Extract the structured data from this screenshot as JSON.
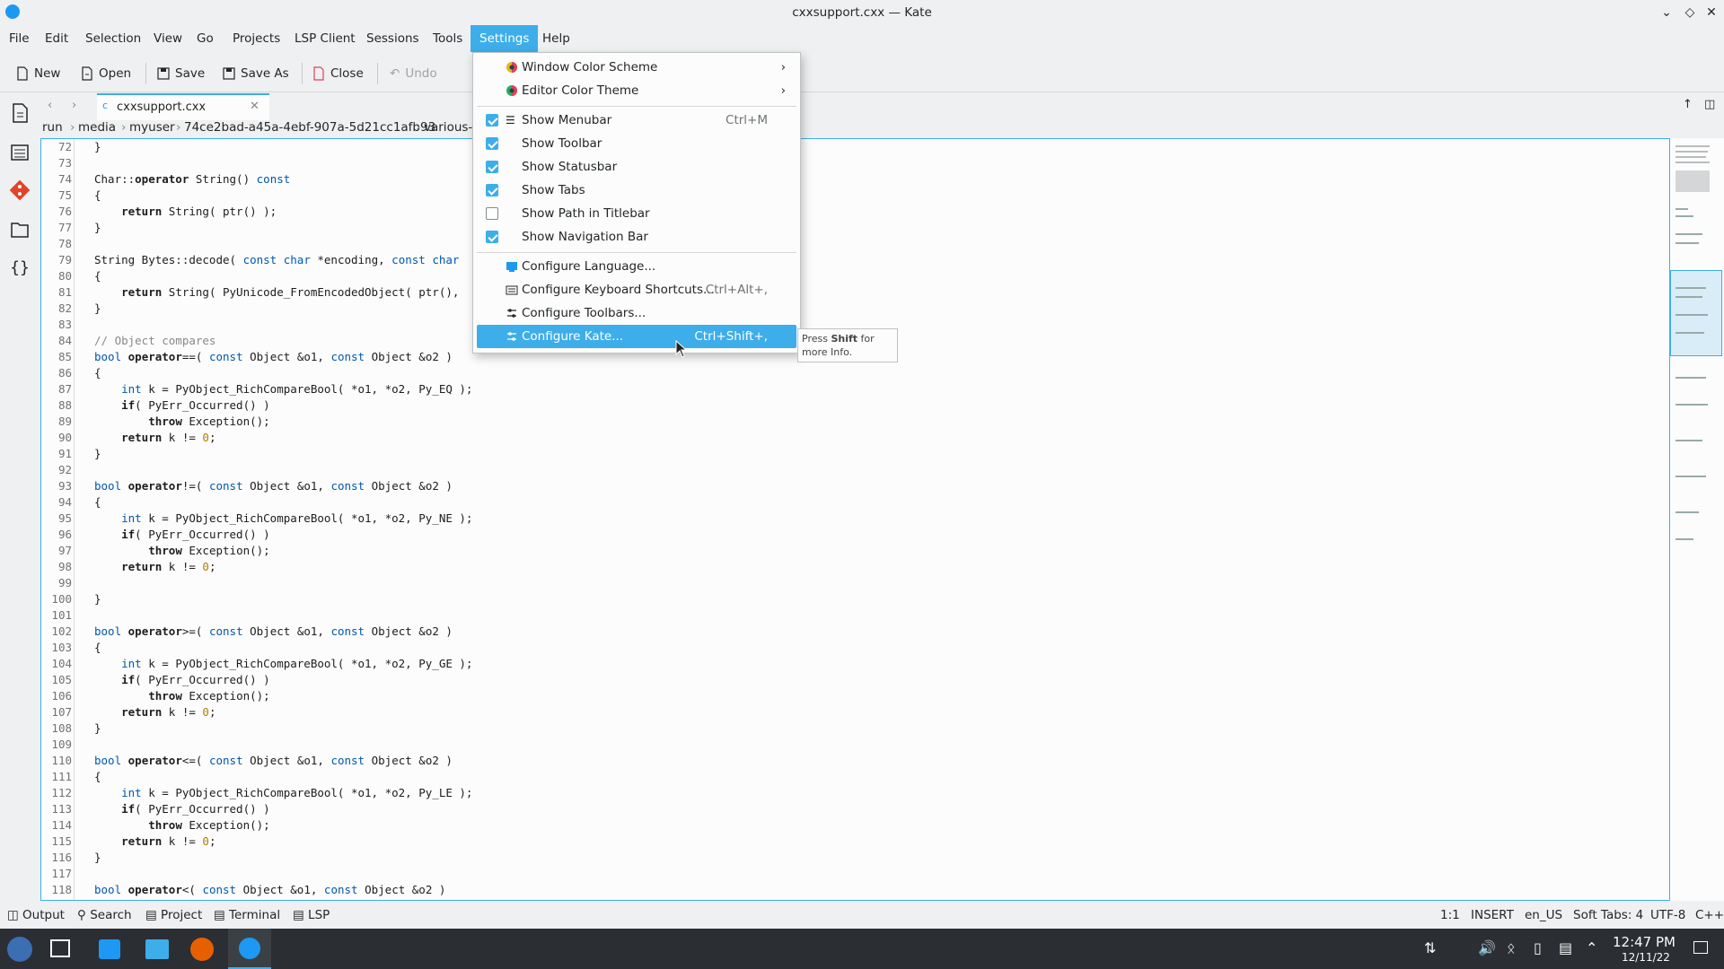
{
  "window": {
    "title": "cxxsupport.cxx — Kate"
  },
  "menubar": [
    "File",
    "Edit",
    "Selection",
    "View",
    "Go",
    "Projects",
    "LSP Client",
    "Sessions",
    "Tools",
    "Settings",
    "Help"
  ],
  "toolbar": {
    "new": "New",
    "open": "Open",
    "save": "Save",
    "save_as": "Save As",
    "close": "Close",
    "undo": "Undo"
  },
  "tab": {
    "name": "cxxsupport.cxx"
  },
  "breadcrumb": [
    "run",
    "media",
    "myuser",
    "74ce2bad-a45a-4ebf-907a-5d21cc1afb93",
    "various-f"
  ],
  "settings_menu": {
    "window_color_scheme": "Window Color Scheme",
    "editor_color_theme": "Editor Color Theme",
    "show_menubar": "Show Menubar",
    "show_menubar_sc": "Ctrl+M",
    "show_toolbar": "Show Toolbar",
    "show_statusbar": "Show Statusbar",
    "show_tabs": "Show Tabs",
    "show_path": "Show Path in Titlebar",
    "show_navbar": "Show Navigation Bar",
    "configure_language": "Configure Language...",
    "configure_shortcuts": "Configure Keyboard Shortcuts...",
    "configure_shortcuts_sc": "Ctrl+Alt+,",
    "configure_toolbars": "Configure Toolbars...",
    "configure_kate": "Configure Kate...",
    "configure_kate_sc": "Ctrl+Shift+,"
  },
  "tooltip": {
    "pre": "Press ",
    "bold": "Shift",
    "post": " for more Info."
  },
  "code_lines": [
    {
      "n": "72",
      "t": "}"
    },
    {
      "n": "73",
      "t": ""
    },
    {
      "n": "74",
      "t": "Char::operator String() const"
    },
    {
      "n": "75",
      "t": "{"
    },
    {
      "n": "76",
      "t": "    return String( ptr() );"
    },
    {
      "n": "77",
      "t": "}"
    },
    {
      "n": "78",
      "t": ""
    },
    {
      "n": "79",
      "t": "String Bytes::decode( const char *encoding, const char"
    },
    {
      "n": "80",
      "t": "{"
    },
    {
      "n": "81",
      "t": "    return String( PyUnicode_FromEncodedObject( ptr(),"
    },
    {
      "n": "82",
      "t": "}"
    },
    {
      "n": "83",
      "t": ""
    },
    {
      "n": "84",
      "t": "// Object compares"
    },
    {
      "n": "85",
      "t": "bool operator==( const Object &o1, const Object &o2 )"
    },
    {
      "n": "86",
      "t": "{"
    },
    {
      "n": "87",
      "t": "    int k = PyObject_RichCompareBool( *o1, *o2, Py_EQ );"
    },
    {
      "n": "88",
      "t": "    if( PyErr_Occurred() )"
    },
    {
      "n": "89",
      "t": "        throw Exception();"
    },
    {
      "n": "90",
      "t": "    return k != 0;"
    },
    {
      "n": "91",
      "t": "}"
    },
    {
      "n": "92",
      "t": ""
    },
    {
      "n": "93",
      "t": "bool operator!=( const Object &o1, const Object &o2 )"
    },
    {
      "n": "94",
      "t": "{"
    },
    {
      "n": "95",
      "t": "    int k = PyObject_RichCompareBool( *o1, *o2, Py_NE );"
    },
    {
      "n": "96",
      "t": "    if( PyErr_Occurred() )"
    },
    {
      "n": "97",
      "t": "        throw Exception();"
    },
    {
      "n": "98",
      "t": "    return k != 0;"
    },
    {
      "n": "99",
      "t": ""
    },
    {
      "n": "100",
      "t": "}"
    },
    {
      "n": "101",
      "t": ""
    },
    {
      "n": "102",
      "t": "bool operator>=( const Object &o1, const Object &o2 )"
    },
    {
      "n": "103",
      "t": "{"
    },
    {
      "n": "104",
      "t": "    int k = PyObject_RichCompareBool( *o1, *o2, Py_GE );"
    },
    {
      "n": "105",
      "t": "    if( PyErr_Occurred() )"
    },
    {
      "n": "106",
      "t": "        throw Exception();"
    },
    {
      "n": "107",
      "t": "    return k != 0;"
    },
    {
      "n": "108",
      "t": "}"
    },
    {
      "n": "109",
      "t": ""
    },
    {
      "n": "110",
      "t": "bool operator<=( const Object &o1, const Object &o2 )"
    },
    {
      "n": "111",
      "t": "{"
    },
    {
      "n": "112",
      "t": "    int k = PyObject_RichCompareBool( *o1, *o2, Py_LE );"
    },
    {
      "n": "113",
      "t": "    if( PyErr_Occurred() )"
    },
    {
      "n": "114",
      "t": "        throw Exception();"
    },
    {
      "n": "115",
      "t": "    return k != 0;"
    },
    {
      "n": "116",
      "t": "}"
    },
    {
      "n": "117",
      "t": ""
    },
    {
      "n": "118",
      "t": "bool operator<( const Object &o1, const Object &o2 )"
    }
  ],
  "bottom_tabs": [
    "Output",
    "Search",
    "Project",
    "Terminal",
    "LSP"
  ],
  "status": {
    "cursor": "1:1",
    "mode": "INSERT",
    "lang": "en_US",
    "tabs": "Soft Tabs: 4",
    "encoding": "UTF-8",
    "syntax": "C++"
  },
  "clock": {
    "time": "12:47 PM",
    "date": "12/11/22"
  },
  "colors": {
    "accent": "#3daee9",
    "taskbar": "#2b2e33"
  }
}
